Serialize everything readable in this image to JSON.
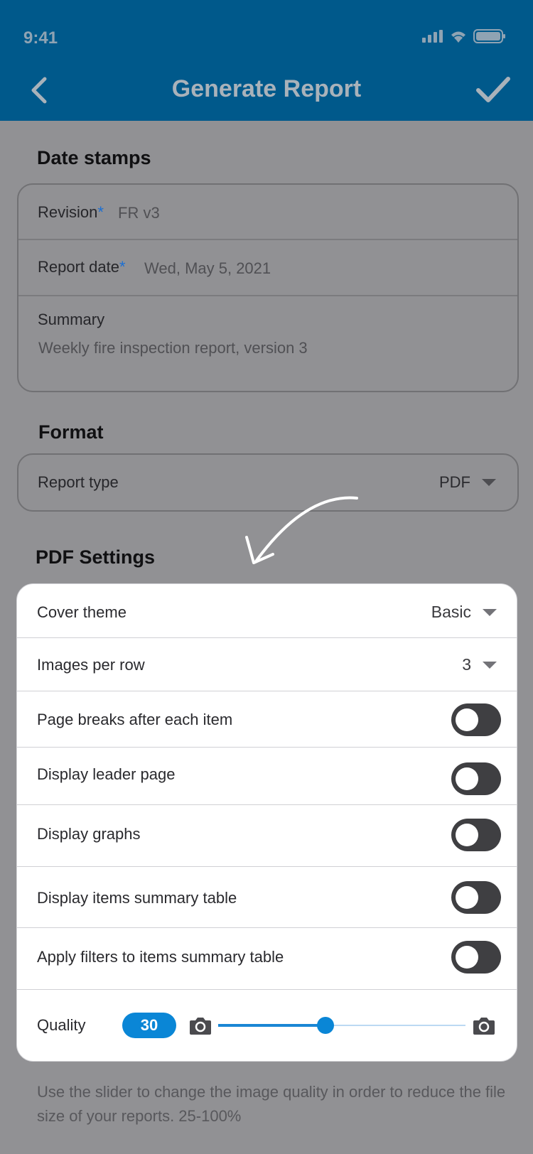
{
  "status_bar": {
    "time": "9:41"
  },
  "header": {
    "title": "Generate Report"
  },
  "date_stamps": {
    "title": "Date stamps",
    "revision": {
      "label": "Revision",
      "required": "*",
      "value": "FR v3"
    },
    "report_date": {
      "label": "Report date",
      "required": "*",
      "value": "Wed, May 5, 2021"
    },
    "summary": {
      "label": "Summary",
      "value": "Weekly fire inspection report, version 3"
    }
  },
  "format": {
    "title": "Format",
    "report_type": {
      "label": "Report type",
      "value": "PDF"
    }
  },
  "pdf_settings": {
    "title": "PDF Settings",
    "cover_theme": {
      "label": "Cover theme",
      "value": "Basic"
    },
    "images_per_row": {
      "label": "Images per row",
      "value": "3"
    },
    "toggles": [
      {
        "label": "Page breaks after each item",
        "on": false
      },
      {
        "label": "Display leader page",
        "on": false
      },
      {
        "label": "Display graphs",
        "on": false
      },
      {
        "label": "Display items summary table",
        "on": false
      },
      {
        "label": "Apply filters to items summary table",
        "on": false
      }
    ],
    "quality": {
      "label": "Quality",
      "value": "30",
      "slider_level": 0.3
    }
  },
  "footer": {
    "note": "Use the slider to change the image quality in order to reduce the file size of your reports. 25-100%"
  },
  "colors": {
    "header": "#00598b",
    "accent": "#0a86d6",
    "overlay": "#919194"
  }
}
